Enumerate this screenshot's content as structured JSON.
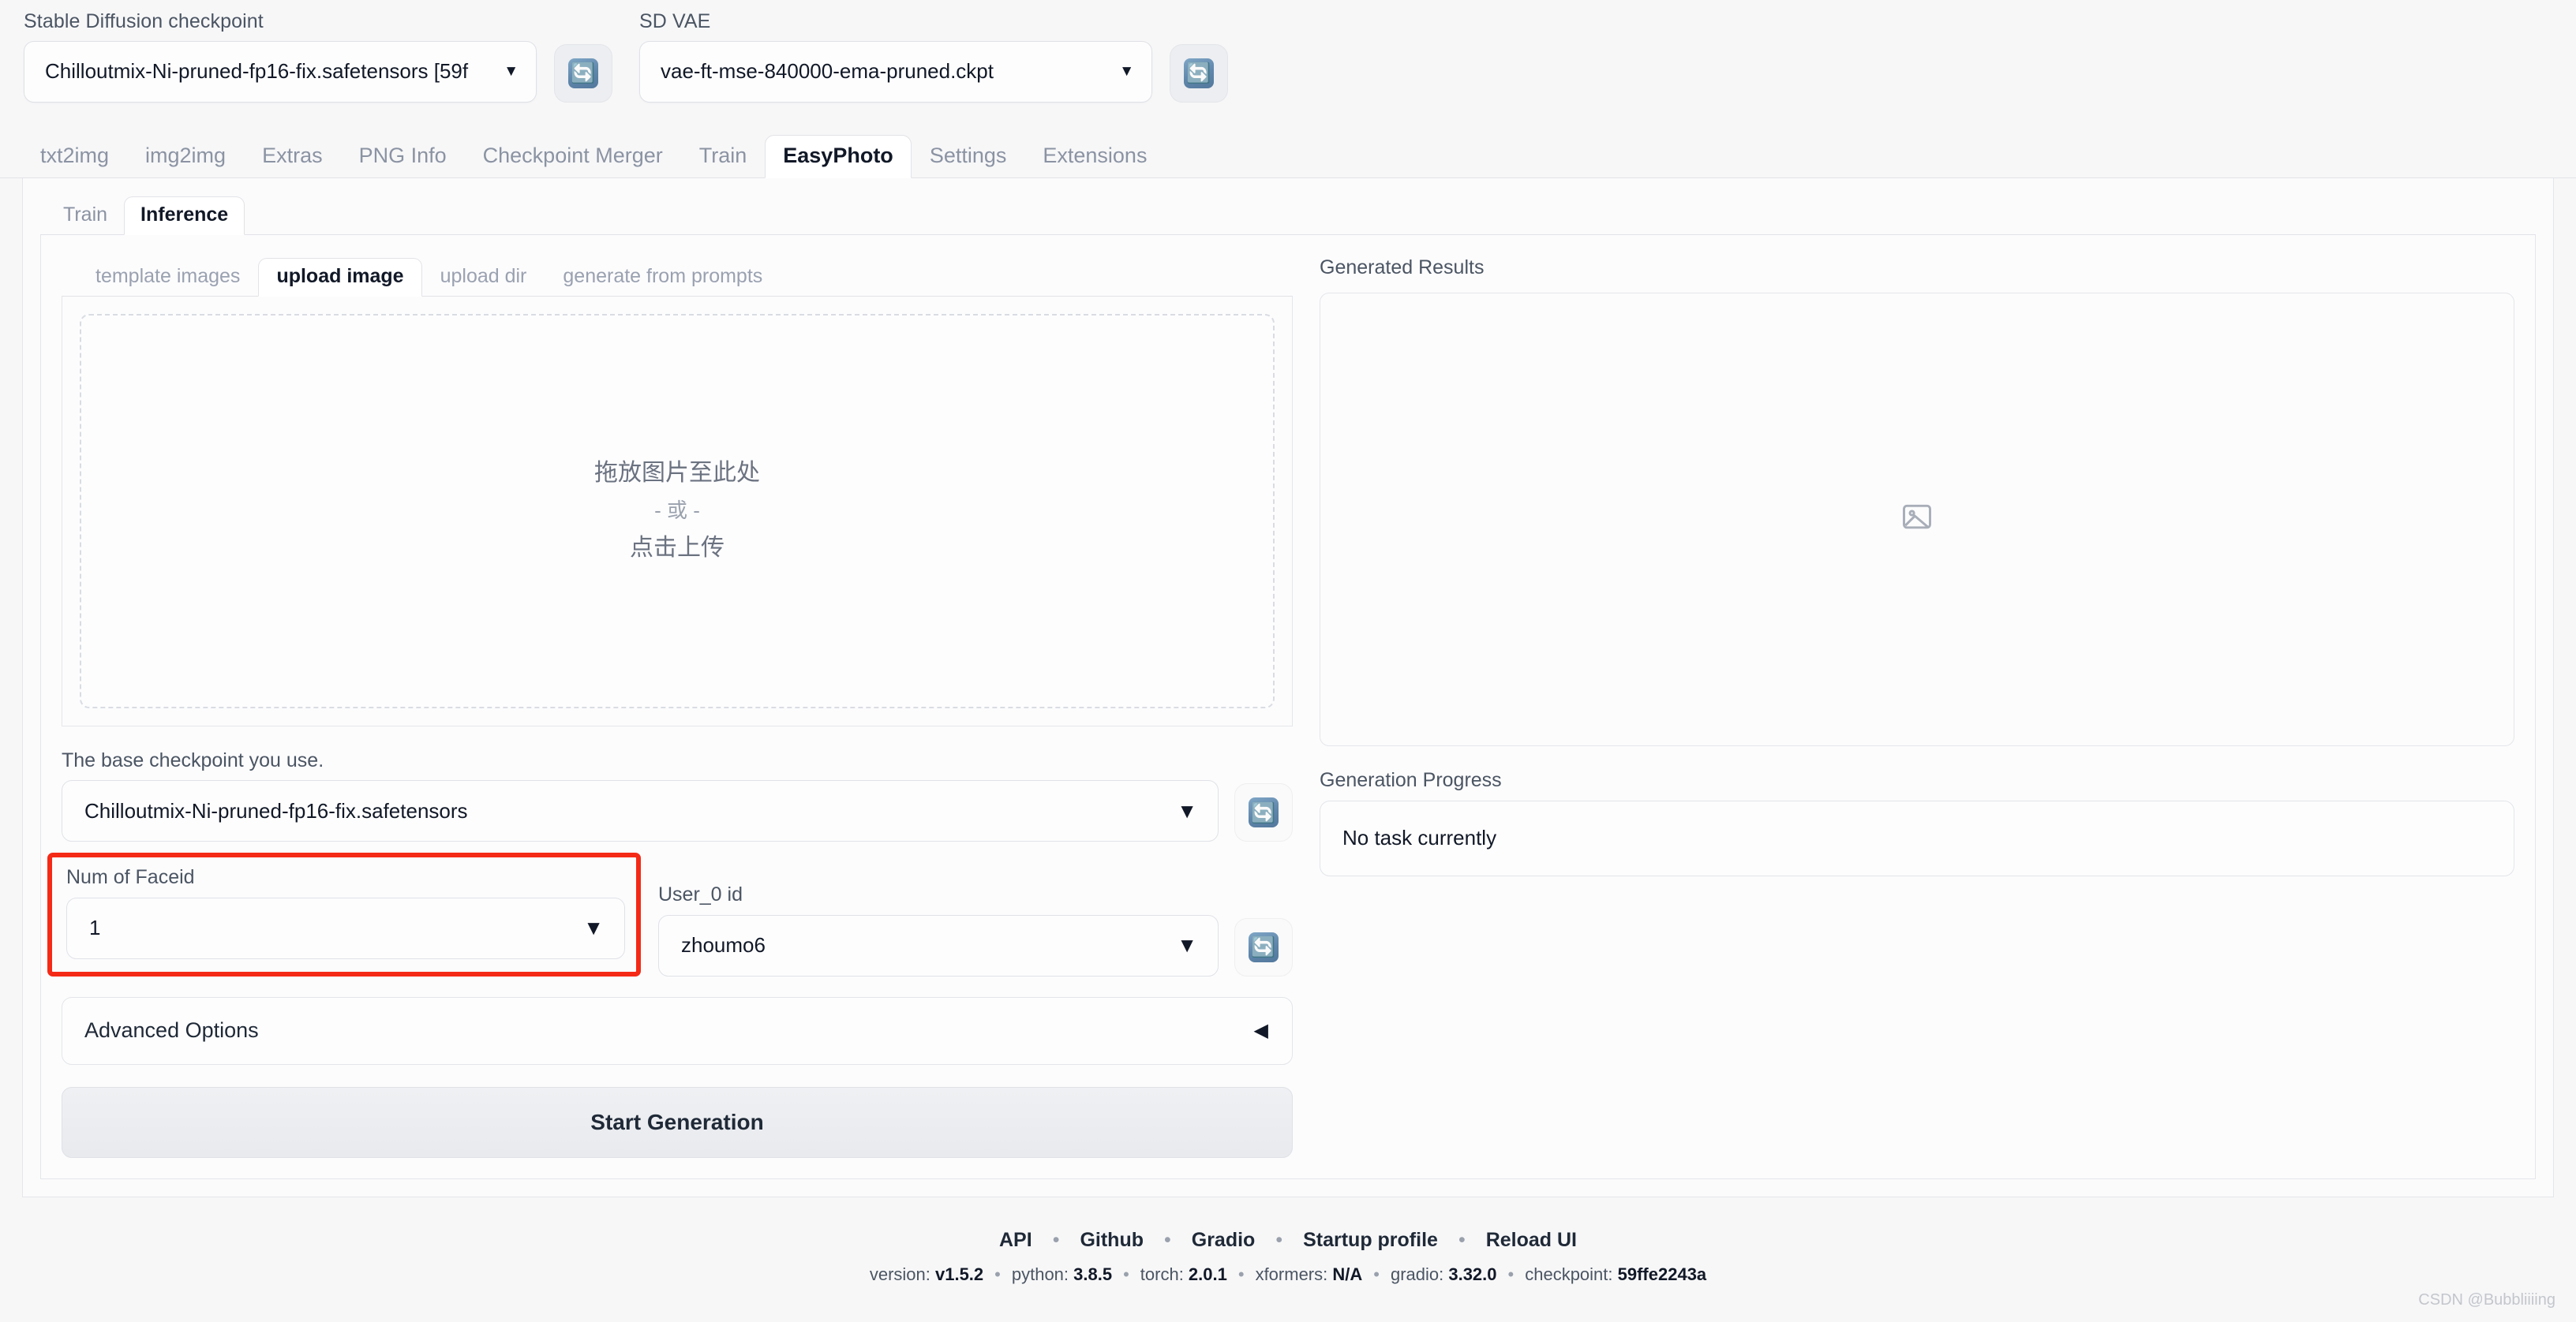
{
  "topbar": {
    "checkpoint": {
      "label": "Stable Diffusion checkpoint",
      "value": "Chilloutmix-Ni-pruned-fp16-fix.safetensors [59f",
      "caret": "▼",
      "refresh_icon": "🔄"
    },
    "vae": {
      "label": "SD VAE",
      "value": "vae-ft-mse-840000-ema-pruned.ckpt",
      "caret": "▼",
      "refresh_icon": "🔄"
    }
  },
  "main_tabs": [
    {
      "label": "txt2img",
      "active": false
    },
    {
      "label": "img2img",
      "active": false
    },
    {
      "label": "Extras",
      "active": false
    },
    {
      "label": "PNG Info",
      "active": false
    },
    {
      "label": "Checkpoint Merger",
      "active": false
    },
    {
      "label": "Train",
      "active": false
    },
    {
      "label": "EasyPhoto",
      "active": true
    },
    {
      "label": "Settings",
      "active": false
    },
    {
      "label": "Extensions",
      "active": false
    }
  ],
  "easyphoto_tabs": [
    {
      "label": "Train",
      "active": false
    },
    {
      "label": "Inference",
      "active": true
    }
  ],
  "source_tabs": [
    {
      "label": "template images",
      "active": false
    },
    {
      "label": "upload image",
      "active": true
    },
    {
      "label": "upload dir",
      "active": false
    },
    {
      "label": "generate from prompts",
      "active": false
    }
  ],
  "dropzone": {
    "main": "拖放图片至此处",
    "or": "- 或 -",
    "click": "点击上传"
  },
  "base_checkpoint": {
    "label": "The base checkpoint you use.",
    "value": "Chilloutmix-Ni-pruned-fp16-fix.safetensors",
    "caret": "▼",
    "refresh_icon": "🔄"
  },
  "num_faceid": {
    "label": "Num of Faceid",
    "value": "1",
    "caret": "▼",
    "highlight_color": "#f42a17"
  },
  "user_id": {
    "label": "User_0 id",
    "value": "zhoumo6",
    "caret": "▼",
    "refresh_icon": "🔄"
  },
  "advanced_options": {
    "label": "Advanced Options",
    "arrow": "◀"
  },
  "start_button": {
    "label": "Start Generation"
  },
  "results": {
    "title": "Generated Results",
    "placeholder_icon": "image-placeholder"
  },
  "progress": {
    "title": "Generation Progress",
    "status": "No task currently"
  },
  "footer": {
    "links": [
      "API",
      "Github",
      "Gradio",
      "Startup profile",
      "Reload UI"
    ],
    "separator": "•",
    "version_items": [
      {
        "key": "version:",
        "val": "v1.5.2"
      },
      {
        "key": "python:",
        "val": "3.8.5"
      },
      {
        "key": "torch:",
        "val": "2.0.1"
      },
      {
        "key": "xformers:",
        "val": "N/A"
      },
      {
        "key": "gradio:",
        "val": "3.32.0"
      },
      {
        "key": "checkpoint:",
        "val": "59ffe2243a"
      }
    ]
  },
  "watermark": "CSDN @Bubbliiiing"
}
